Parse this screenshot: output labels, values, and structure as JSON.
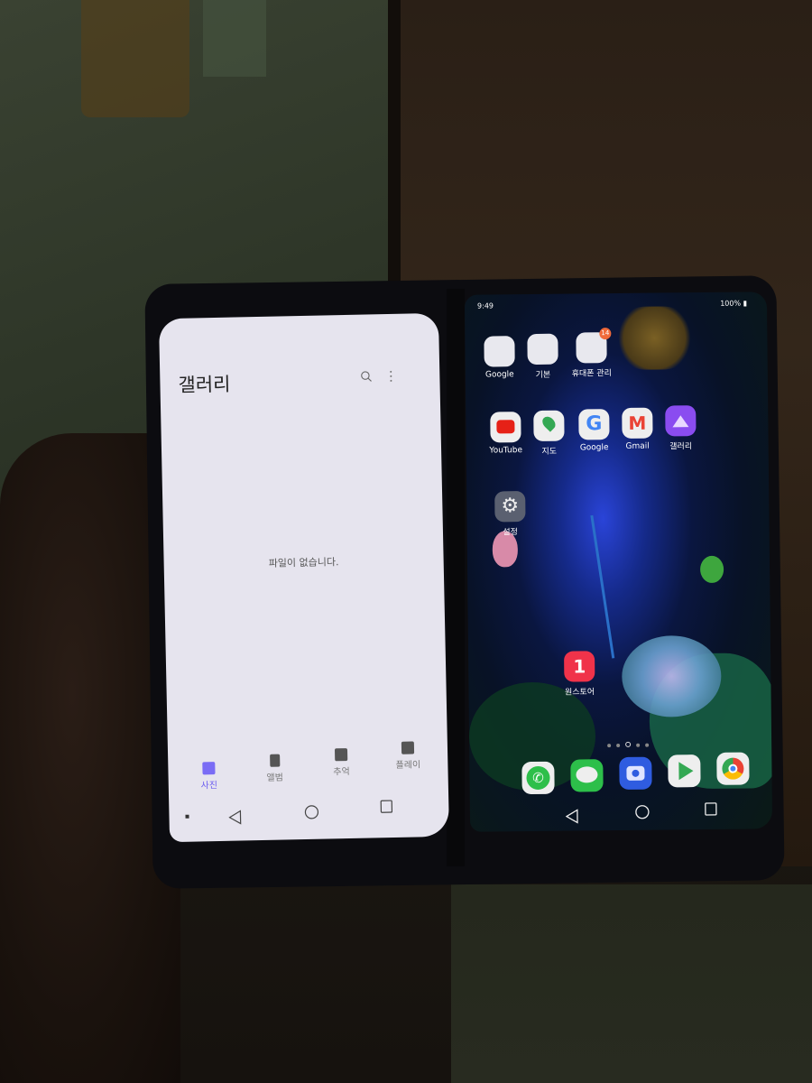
{
  "scene": {
    "description": "Photo of an LG dual-screen phone held in hand in a dim room",
    "accent_color": "#6b5cf0"
  },
  "left_screen": {
    "app_title": "갤러리",
    "search_icon": "search-icon",
    "more_icon": "more-vert-icon",
    "empty_message": "파일이 없습니다.",
    "tabs": [
      {
        "label": "사진",
        "icon": "photo-icon",
        "active": true
      },
      {
        "label": "앨범",
        "icon": "album-icon",
        "active": false
      },
      {
        "label": "추억",
        "icon": "memories-icon",
        "active": false
      },
      {
        "label": "플레이",
        "icon": "play-film-icon",
        "active": false
      }
    ],
    "nav": [
      "back",
      "home",
      "recents"
    ]
  },
  "right_screen": {
    "status": {
      "time": "9:49",
      "battery": "100%"
    },
    "folders": [
      {
        "label": "Google"
      },
      {
        "label": "기본"
      },
      {
        "label": "휴대폰 관리",
        "badge": "14"
      }
    ],
    "apps_row2": [
      {
        "label": "YouTube",
        "color": "#e62117"
      },
      {
        "label": "지도",
        "color": "#34a853"
      },
      {
        "label": "Google",
        "color": "#4285f4"
      },
      {
        "label": "Gmail",
        "color": "#ea4335"
      },
      {
        "label": "갤러리",
        "color": "#8a4cf0"
      }
    ],
    "apps_row3": [
      {
        "label": "설정",
        "color": "#5a6070"
      }
    ],
    "apps_row4": [
      {
        "label": "원스토어",
        "color": "#f0334a",
        "glyph": "1"
      }
    ],
    "page_indicator": {
      "pages": 5,
      "current": 3
    },
    "dock": [
      {
        "name": "phone",
        "color": "#2dbf4a"
      },
      {
        "name": "messages",
        "color": "#2dbf4a"
      },
      {
        "name": "camera",
        "color": "#2f5ce0"
      },
      {
        "name": "play-store",
        "color": "#f0f0f0"
      },
      {
        "name": "chrome",
        "color": "#f0f0f0"
      }
    ],
    "nav": [
      "back",
      "home",
      "recents"
    ]
  }
}
